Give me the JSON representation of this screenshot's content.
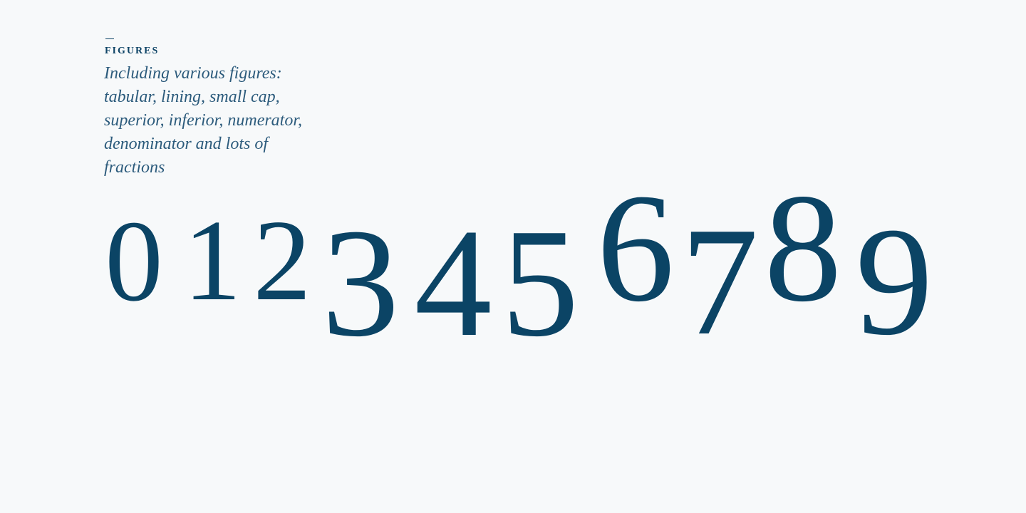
{
  "section": {
    "label": "FIGURES",
    "description": "Including various figures: tabular, lining, small cap, superior, inferior, numerator, denominator and lots of fractions"
  },
  "figures": [
    "0",
    "1",
    "2",
    "3",
    "4",
    "5",
    "6",
    "7",
    "8",
    "9"
  ],
  "colors": {
    "background": "#f7f9fa",
    "accent": "#0b4465",
    "text_secondary": "#2c5b7c"
  }
}
